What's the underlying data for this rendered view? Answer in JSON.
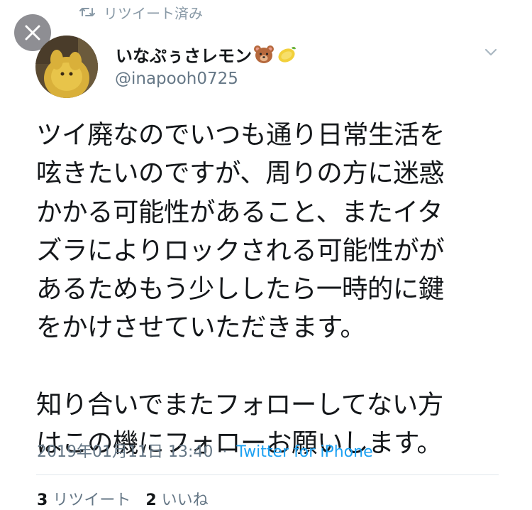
{
  "retweet": {
    "icon": "retweet-icon",
    "label": "リツイート済み"
  },
  "close": {
    "icon": "close-icon"
  },
  "user": {
    "display_name": "いなぷぅさレモン",
    "emoji": [
      "🐻",
      "🍋"
    ],
    "handle": "@inapooh0725"
  },
  "tweet": {
    "lines": [
      "ツイ廃なのでいつも通り日常生活を",
      "呟きたいのですが、周りの方に迷惑",
      "かかる可能性があること、またイタ",
      "ズラによりロックされる可能性がが",
      "あるためもう少ししたら一時的に鍵",
      "をかけさせていただきます。"
    ],
    "lines2": [
      "知り合いでまたフォローしてない方",
      "はこの機にフォローお願いします。"
    ]
  },
  "meta": {
    "timestamp": "2019年01月11日 13:40",
    "separator": "·",
    "source": "Twitter for iPhone"
  },
  "stats": {
    "retweets_count": "3",
    "retweets_label": "リツイート",
    "likes_count": "2",
    "likes_label": "いいね"
  },
  "colors": {
    "accent": "#1da1f2",
    "secondary_text": "#657786",
    "close_bg": "#8e8e93"
  }
}
